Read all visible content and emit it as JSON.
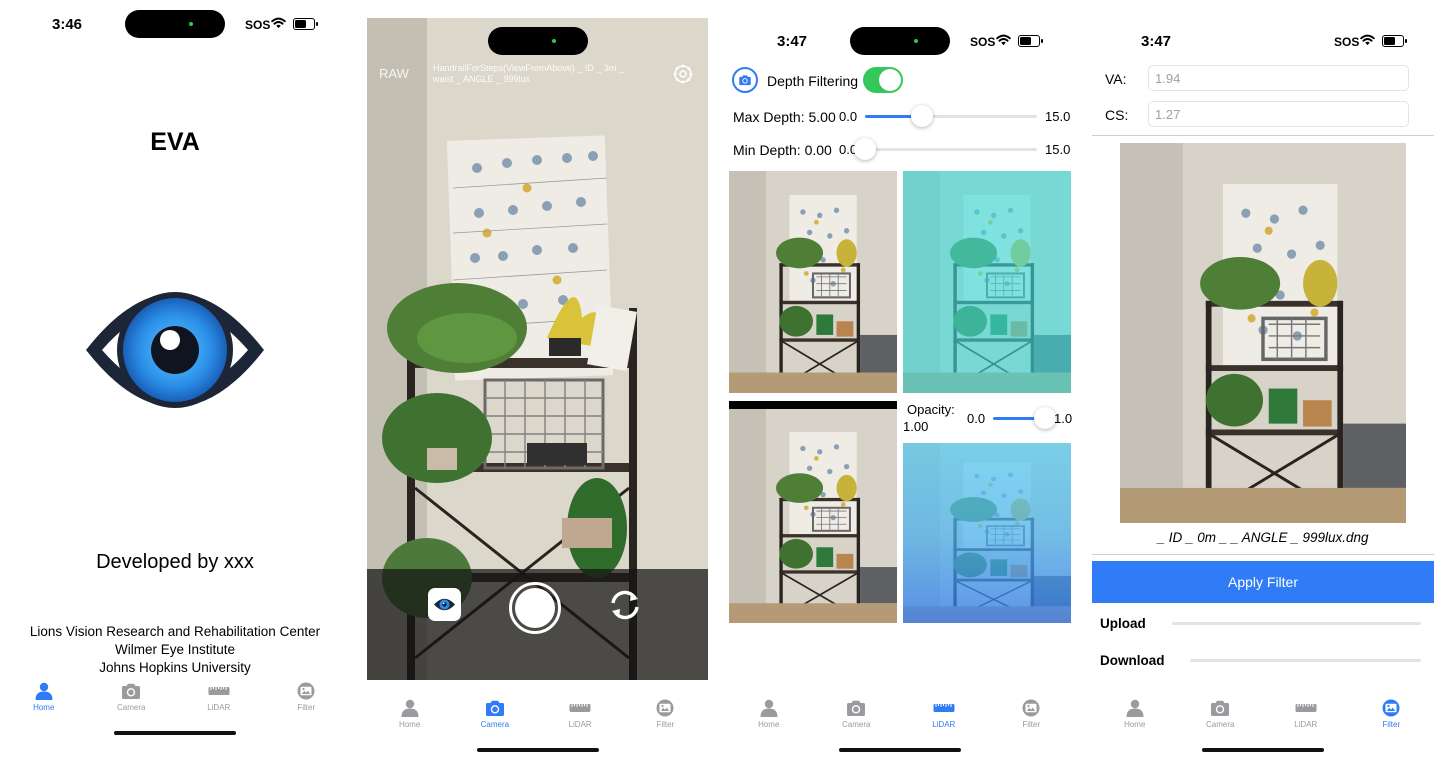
{
  "phones": {
    "home": {
      "time": "3:46",
      "sos": "SOS",
      "app_title": "EVA",
      "developed_by": "Developed by xxx",
      "org_line1": "Lions Vision Research and Rehabilitation Center",
      "org_line2": "Wilmer Eye Institute",
      "org_line3": "Johns Hopkins University"
    },
    "camera": {
      "raw_label": "RAW",
      "filename_line1": "HandrailForSteps(ViewFromAbove) _ ID _ 3m _",
      "filename_line2": "waist _ ANGLE _ 999lux"
    },
    "lidar": {
      "time": "3:47",
      "sos": "SOS",
      "depth_filtering_label": "Depth Filtering",
      "depth_filtering_on": true,
      "max_depth_label": "Max Depth: 5.00",
      "max_depth_min": "0.0",
      "max_depth_max": "15.0",
      "max_depth_value": 5.0,
      "min_depth_label": "Min Depth: 0.00",
      "min_depth_min": "0.0",
      "min_depth_max": "15.0",
      "min_depth_value": 0.0,
      "opacity_label": "Opacity:",
      "opacity_value_text": "1.00",
      "opacity_min": "0.0",
      "opacity_max": "1.0",
      "opacity_value": 1.0
    },
    "filter": {
      "time": "3:47",
      "sos": "SOS",
      "va_label": "VA:",
      "va_placeholder": "1.94",
      "cs_label": "CS:",
      "cs_placeholder": "1.27",
      "image_caption": "_ ID _ 0m _ _ ANGLE _ 999lux.dng",
      "apply_button": "Apply Filter",
      "upload_label": "Upload",
      "download_label": "Download"
    }
  },
  "tabs": {
    "home": "Home",
    "camera": "Camera",
    "lidar": "LiDAR",
    "filter": "Filter"
  },
  "colors": {
    "accent": "#2f7cf6",
    "inactive_tab": "#9b9b9f",
    "toggle_on": "#34c759",
    "apply_button_bg": "#2f7cf6"
  }
}
